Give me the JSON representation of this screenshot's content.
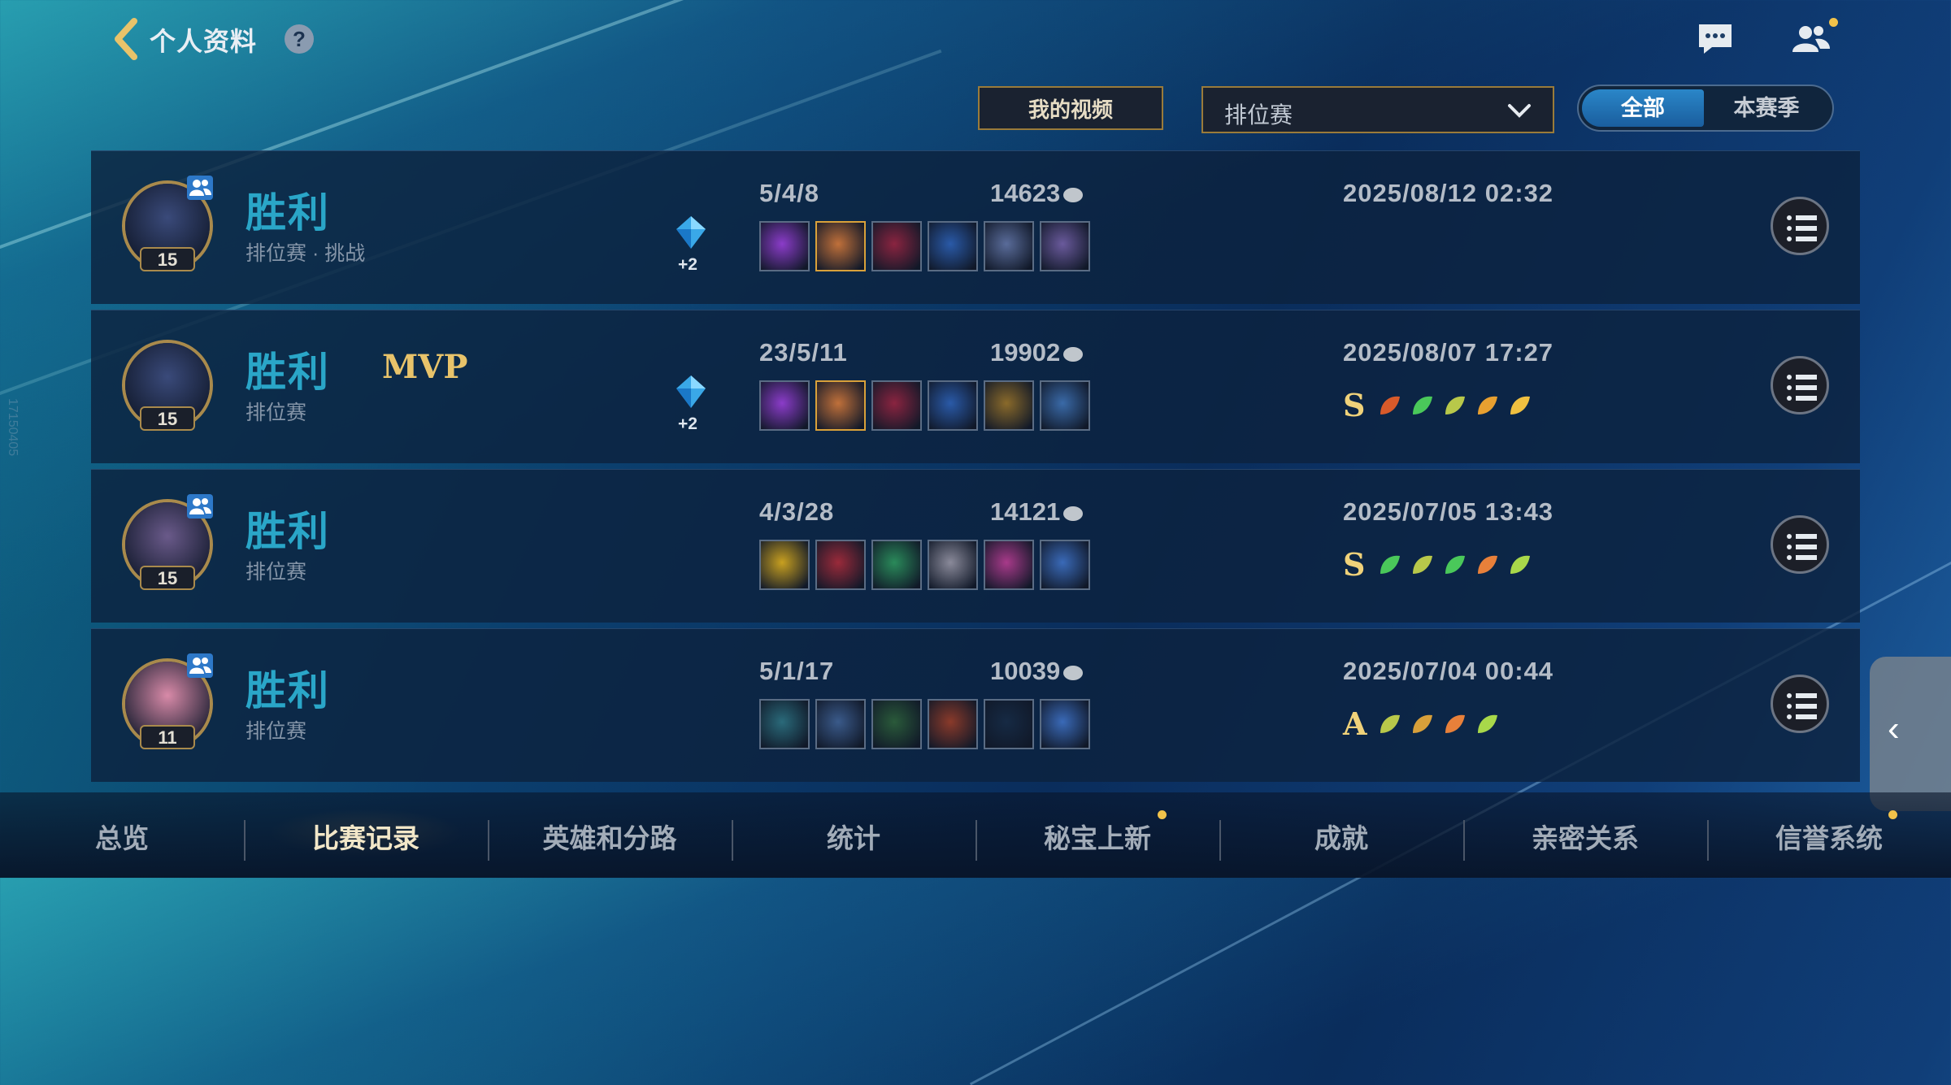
{
  "header": {
    "title": "个人资料",
    "help": "?"
  },
  "watermark": "17150405",
  "controls": {
    "video_button": "我的视频",
    "mode_select": "排位赛",
    "segment": [
      "全部",
      "本赛季"
    ]
  },
  "matches": [
    {
      "result": "胜利",
      "mode": "排位赛 · 挑战",
      "level": "15",
      "mvp": "",
      "gems": "+2",
      "kda": "5/4/8",
      "gold": "14623",
      "date": "2025/08/12 02:32",
      "grade": "",
      "avatar_color": "#3a4a7a"
    },
    {
      "result": "胜利",
      "mode": "排位赛",
      "level": "15",
      "mvp": "MVP",
      "gems": "+2",
      "kda": "23/5/11",
      "gold": "19902",
      "date": "2025/08/07 17:27",
      "grade": "S",
      "avatar_color": "#3a4a7a"
    },
    {
      "result": "胜利",
      "mode": "排位赛",
      "level": "15",
      "mvp": "",
      "gems": "",
      "kda": "4/3/28",
      "gold": "14121",
      "date": "2025/07/05 13:43",
      "grade": "S",
      "avatar_color": "#6a5a8a"
    },
    {
      "result": "胜利",
      "mode": "排位赛",
      "level": "11",
      "mvp": "",
      "gems": "",
      "kda": "5/1/17",
      "gold": "10039",
      "date": "2025/07/04 00:44",
      "grade": "A",
      "avatar_color": "#d88aa8"
    }
  ],
  "tabs": [
    "总览",
    "比赛记录",
    "英雄和分路",
    "统计",
    "秘宝上新",
    "成就",
    "亲密关系",
    "信誉系统"
  ],
  "active_tab": "比赛记录",
  "colors": {
    "victory": "#2aa6c8",
    "accent_gold": "#e8c36a",
    "notification_dot": "#f1c24a"
  }
}
